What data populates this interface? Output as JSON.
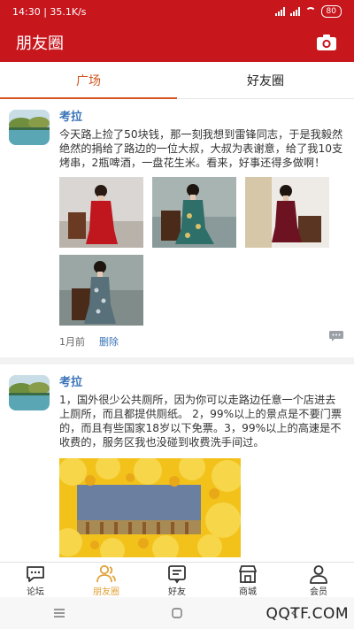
{
  "status_bar": {
    "time_speed": "14:30 | 35.1K/s",
    "battery": "80"
  },
  "header": {
    "title": "朋友圈"
  },
  "tabs": [
    {
      "label": "广场",
      "active": true
    },
    {
      "label": "好友圈",
      "active": false
    }
  ],
  "posts": [
    {
      "author": "考拉",
      "text": "今天路上捡了50块钱，那一刻我想到雷锋同志，于是我毅然绝然的捐给了路边的一位大叔，大叔为表谢意，给了我10支烤串，2瓶啤酒，一盘花生米。看来，好事还得多做啊！",
      "time": "1月前",
      "delete_label": "删除"
    },
    {
      "author": "考拉",
      "text": "1，国外很少公共厕所，因为你可以走路边任意一个店进去上厕所，而且都提供厕纸。 2，99%以上的景点是不要门票的，而且有些国家18岁以下免票。3，99%以上的高速是不收费的，服务区我也没碰到收费洗手间过。"
    }
  ],
  "bottom_nav": [
    {
      "label": "论坛",
      "icon": "chat-icon"
    },
    {
      "label": "朋友圈",
      "icon": "people-icon",
      "active": true
    },
    {
      "label": "好友",
      "icon": "contact-card-icon"
    },
    {
      "label": "商城",
      "icon": "store-icon"
    },
    {
      "label": "会员",
      "icon": "user-icon"
    }
  ],
  "watermark": "QQTF.COM",
  "colors": {
    "brand_red": "#c8161d",
    "tab_accent": "#d4551f",
    "link_blue": "#3a74b8",
    "nav_active": "#e2a23a"
  }
}
